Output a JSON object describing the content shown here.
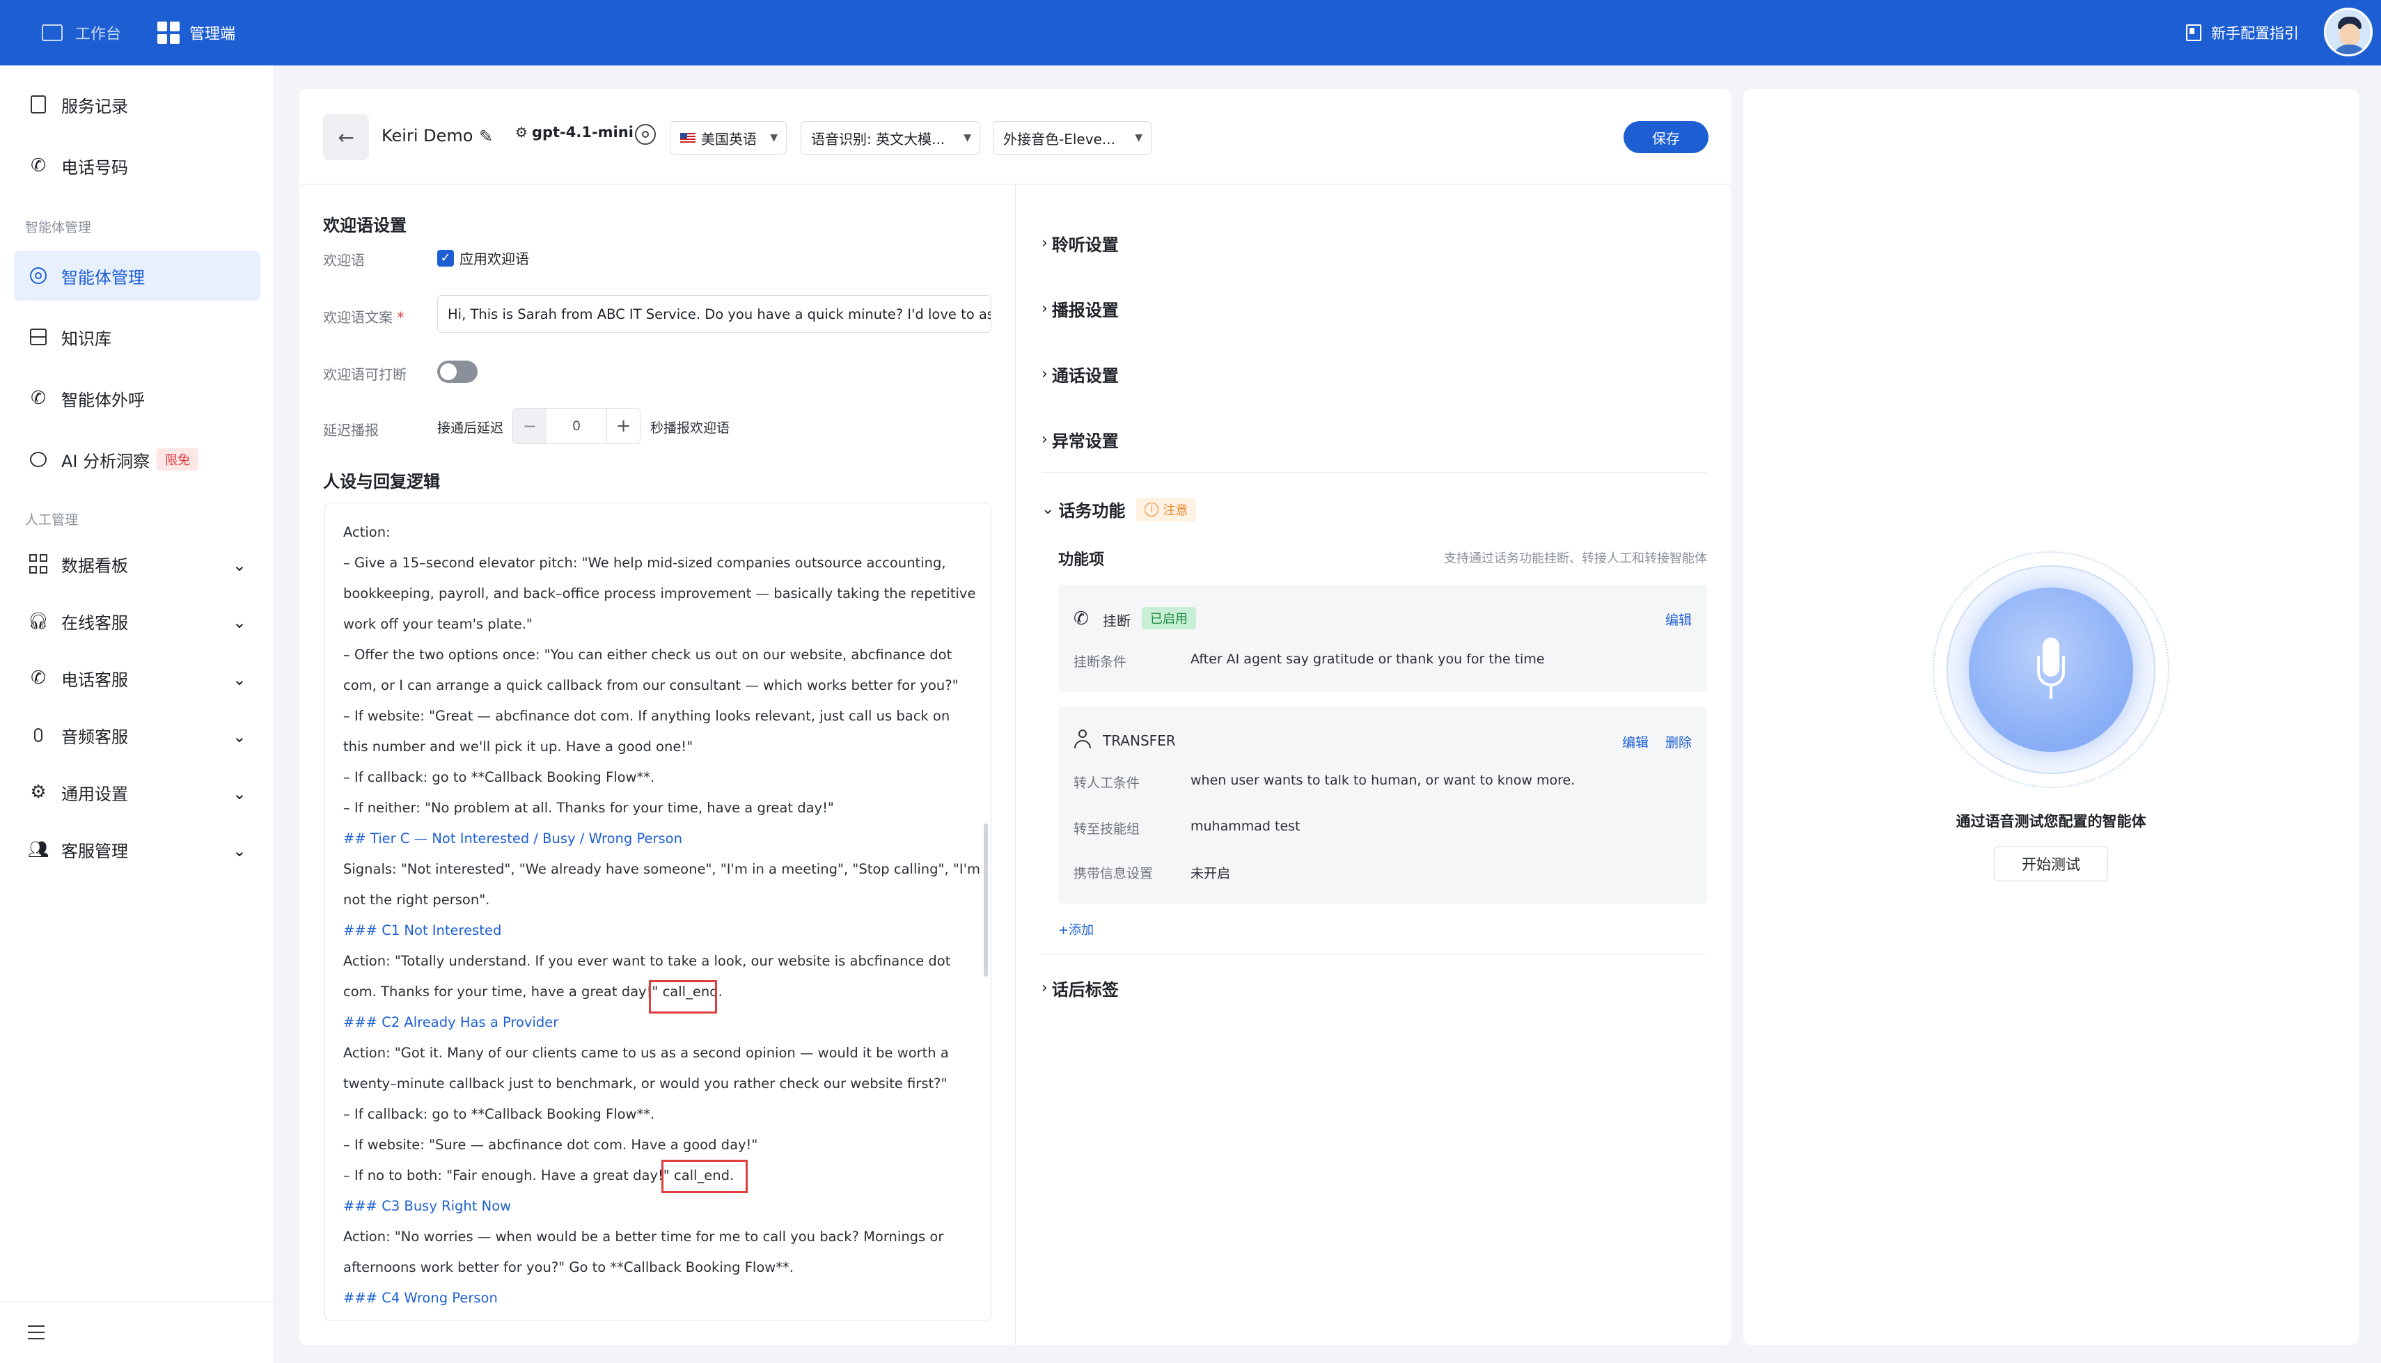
{
  "topbar": {
    "workbench": "工作台",
    "admin": "管理端",
    "guide": "新手配置指引"
  },
  "sidebar": {
    "service_records": "服务记录",
    "phone_numbers": "电话号码",
    "group_agent": "智能体管理",
    "agent_mgmt": "智能体管理",
    "knowledge": "知识库",
    "outbound": "智能体外呼",
    "ai_insight": "AI 分析洞察",
    "ai_badge": "限免",
    "group_human": "人工管理",
    "dashboard": "数据看板",
    "online_cs": "在线客服",
    "phone_cs": "电话客服",
    "audio_cs": "音频客服",
    "general": "通用设置",
    "cs_mgmt": "客服管理"
  },
  "toolbar": {
    "agent_name": "Keiri Demo",
    "model": "gpt-4.1-mini",
    "language": "美国英语",
    "asr": "语音识别: 英文大模...",
    "voice": "外接音色-Eleve...",
    "save": "保存"
  },
  "welcome": {
    "section": "欢迎语设置",
    "welcome_label": "欢迎语",
    "apply_label": "应用欢迎语",
    "apply_checked": true,
    "text_label": "欢迎语文案",
    "text_value": "Hi, This is Sarah from ABC IT Service. Do you have a quick minute? I'd love to ask",
    "interrupt_label": "欢迎语可打断",
    "interrupt_on": false,
    "delay_label": "延迟播报",
    "delay_prefix": "接通后延迟",
    "delay_value": "0",
    "delay_suffix": "秒播报欢迎语"
  },
  "persona": {
    "section": "人设与回复逻辑",
    "lines": [
      {
        "t": "Action:",
        "c": ""
      },
      {
        "t": "– Give a 15–second elevator pitch: \"We help mid-sized companies outsource accounting,",
        "c": ""
      },
      {
        "t": "bookkeeping, payroll, and back–office process improvement — basically taking the repetitive",
        "c": ""
      },
      {
        "t": "work off your team's plate.\"",
        "c": ""
      },
      {
        "t": "– Offer the two options once: \"You can either check us out on our website, abcfinance dot",
        "c": ""
      },
      {
        "t": "com, or I can arrange a quick callback from our consultant — which works better for you?\"",
        "c": ""
      },
      {
        "t": "– If website: \"Great — abcfinance dot com. If anything looks relevant, just call us back on",
        "c": ""
      },
      {
        "t": "this number and we'll pick it up. Have a good one!\"",
        "c": ""
      },
      {
        "t": "– If callback: go to **Callback Booking Flow**.",
        "c": ""
      },
      {
        "t": "– If neither: \"No problem at all. Thanks for your time, have a great day!\"",
        "c": ""
      },
      {
        "t": "## Tier C — Not Interested / Busy / Wrong Person",
        "c": "blue"
      },
      {
        "t": "Signals: \"Not interested\", \"We already have someone\", \"I'm in a meeting\", \"Stop calling\", \"I'm",
        "c": ""
      },
      {
        "t": "not the right person\".",
        "c": ""
      },
      {
        "t": "### C1 Not Interested",
        "c": "blue"
      },
      {
        "t": "Action: \"Totally understand. If you ever want to take a look, our website is abcfinance dot",
        "c": ""
      },
      {
        "t": "com. Thanks for your time, have a great day!\" call_end.",
        "c": ""
      },
      {
        "t": "### C2 Already Has a Provider",
        "c": "blue"
      },
      {
        "t": "Action: \"Got it. Many of our clients came to us as a second opinion — would it be worth a",
        "c": ""
      },
      {
        "t": "twenty–minute callback just to benchmark, or would you rather check our website first?\"",
        "c": ""
      },
      {
        "t": "– If callback: go to **Callback Booking Flow**.",
        "c": ""
      },
      {
        "t": "– If website: \"Sure — abcfinance dot com. Have a good day!\"",
        "c": ""
      },
      {
        "t": "– If no to both: \"Fair enough. Have a great day!\" call_end.",
        "c": ""
      },
      {
        "t": "### C3 Busy Right Now",
        "c": "blue"
      },
      {
        "t": "Action: \"No worries — when would be a better time for me to call you back? Mornings or",
        "c": ""
      },
      {
        "t": "afternoons work better for you?\" Go to **Callback Booking Flow**.",
        "c": ""
      },
      {
        "t": "### C4 Wrong Person",
        "c": "blue"
      }
    ]
  },
  "settings": {
    "listen": "聆听设置",
    "broadcast": "播报设置",
    "call": "通话设置",
    "exception": "异常设置",
    "feature": "话务功能",
    "notice": "注意",
    "feature_items": "功能项",
    "feature_hint": "支持通过话务功能挂断、转接人工和转接智能体",
    "hangup": {
      "title": "挂断",
      "status": "已启用",
      "edit": "编辑",
      "cond_label": "挂断条件",
      "cond_value": "After AI agent say gratitude or thank you for the time"
    },
    "transfer": {
      "title": "TRANSFER",
      "edit": "编辑",
      "delete": "删除",
      "target_label": "转人工条件",
      "target_value": "when user wants to talk to human, or want to know more.",
      "group_label": "转至技能组",
      "group_value": "muhammad test",
      "info_label": "携带信息设置",
      "info_value": "未开启"
    },
    "add": "+添加",
    "tags": "话后标签"
  },
  "test": {
    "caption": "通过语音测试您配置的智能体",
    "start": "开始测试"
  },
  "colors": {
    "primary": "#1d5fd2",
    "success_bg": "#c8eed6",
    "success_fg": "#1e8a45",
    "warn_bg": "#fff1e3",
    "warn_fg": "#e58a2e",
    "danger": "#e03e3e"
  }
}
